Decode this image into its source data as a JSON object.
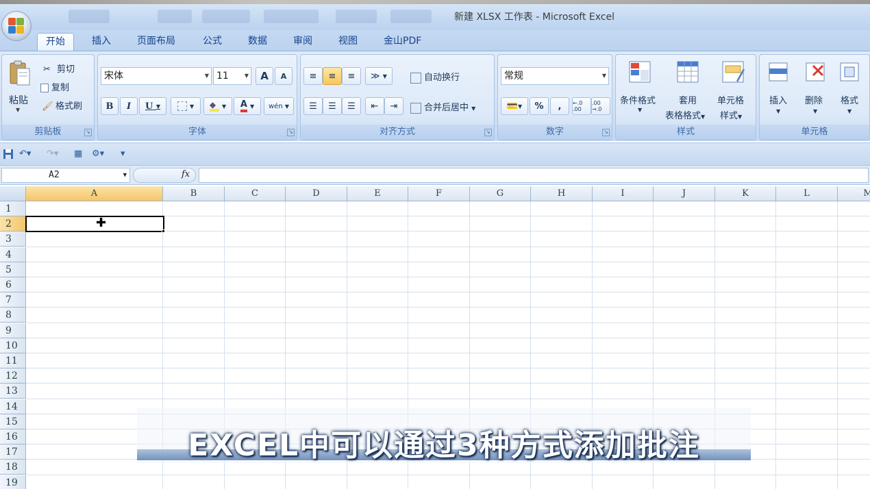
{
  "window": {
    "title": "新建 XLSX 工作表 - Microsoft Excel"
  },
  "tabs": [
    "开始",
    "插入",
    "页面布局",
    "公式",
    "数据",
    "审阅",
    "视图",
    "金山PDF"
  ],
  "active_tab": "开始",
  "ribbon": {
    "clipboard": {
      "label": "剪贴板",
      "paste": "粘贴",
      "cut": "剪切",
      "copy": "复制",
      "format_painter": "格式刷"
    },
    "font": {
      "label": "字体",
      "font_name": "宋体",
      "font_size": "11",
      "bold": "B",
      "italic": "I",
      "underline": "U",
      "font_color": "A",
      "grow": "A",
      "shrink": "A",
      "phonetic": "wén"
    },
    "alignment": {
      "label": "对齐方式",
      "wrap_text": "自动换行",
      "merge_center": "合并后居中"
    },
    "number": {
      "label": "数字",
      "format": "常规",
      "percent": "%",
      "comma": ",",
      "inc_decimal": "←.0 .00",
      "dec_decimal": ".00 →.0"
    },
    "styles": {
      "label": "样式",
      "conditional": "条件格式",
      "table_format_1": "套用",
      "table_format_2": "表格格式",
      "cell_styles_1": "单元格",
      "cell_styles_2": "样式"
    },
    "cells": {
      "label": "单元格",
      "insert": "插入",
      "delete": "删除",
      "format": "格式"
    }
  },
  "formula_bar": {
    "name_box": "A2",
    "fx": "fx",
    "value": ""
  },
  "grid": {
    "columns": [
      "A",
      "B",
      "C",
      "D",
      "E",
      "F",
      "G",
      "H",
      "I",
      "J",
      "K",
      "L",
      "M"
    ],
    "rows": [
      "1",
      "2",
      "3",
      "4",
      "5",
      "6",
      "7",
      "8",
      "9",
      "10",
      "11",
      "12",
      "13",
      "14",
      "15",
      "16",
      "17",
      "18",
      "19"
    ],
    "selected_cell": "A2"
  },
  "caption": "EXCEL中可以通过3种方式添加批注",
  "colors": {
    "ribbon_bg": "#dfeaf7",
    "tab_text": "#15428b",
    "selected_header": "#f6c56a",
    "grid_line": "#d6e0ec"
  }
}
